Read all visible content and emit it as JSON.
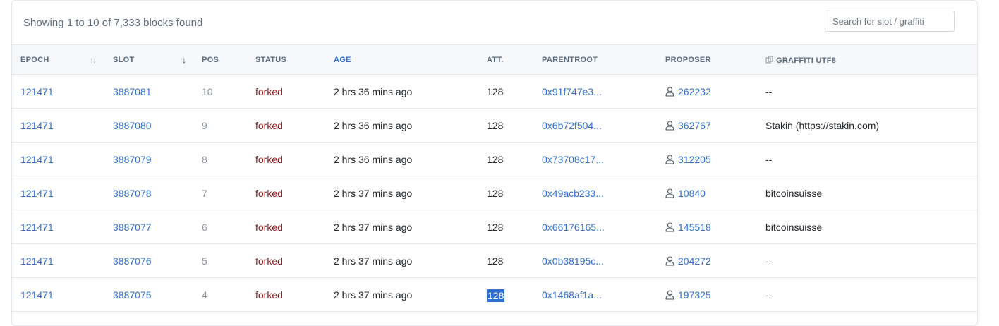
{
  "summary": "Showing 1 to 10 of 7,333 blocks found",
  "search": {
    "placeholder": "Search for slot / graffiti"
  },
  "columns": {
    "epoch": "EPOCH",
    "slot": "SLOT",
    "pos": "POS",
    "status": "STATUS",
    "age": "AGE",
    "att": "ATT.",
    "parentroot": "PARENTROOT",
    "proposer": "PROPOSER",
    "graffiti": "GRAFFITI UTF8"
  },
  "rows": [
    {
      "epoch": "121471",
      "slot": "3887081",
      "pos": "10",
      "status": "forked",
      "age": "2 hrs 36 mins ago",
      "att": "128",
      "parentroot": "0x91f747e3...",
      "proposer": "262232",
      "graffiti": "--"
    },
    {
      "epoch": "121471",
      "slot": "3887080",
      "pos": "9",
      "status": "forked",
      "age": "2 hrs 36 mins ago",
      "att": "128",
      "parentroot": "0x6b72f504...",
      "proposer": "362767",
      "graffiti": "Stakin (https://stakin.com)"
    },
    {
      "epoch": "121471",
      "slot": "3887079",
      "pos": "8",
      "status": "forked",
      "age": "2 hrs 36 mins ago",
      "att": "128",
      "parentroot": "0x73708c17...",
      "proposer": "312205",
      "graffiti": "--"
    },
    {
      "epoch": "121471",
      "slot": "3887078",
      "pos": "7",
      "status": "forked",
      "age": "2 hrs 37 mins ago",
      "att": "128",
      "parentroot": "0x49acb233...",
      "proposer": "10840",
      "graffiti": "bitcoinsuisse"
    },
    {
      "epoch": "121471",
      "slot": "3887077",
      "pos": "6",
      "status": "forked",
      "age": "2 hrs 37 mins ago",
      "att": "128",
      "parentroot": "0x66176165...",
      "proposer": "145518",
      "graffiti": "bitcoinsuisse"
    },
    {
      "epoch": "121471",
      "slot": "3887076",
      "pos": "5",
      "status": "forked",
      "age": "2 hrs 37 mins ago",
      "att": "128",
      "parentroot": "0x0b38195c...",
      "proposer": "204272",
      "graffiti": "--"
    },
    {
      "epoch": "121471",
      "slot": "3887075",
      "pos": "4",
      "status": "forked",
      "age": "2 hrs 37 mins ago",
      "att": "128",
      "parentroot": "0x1468af1a...",
      "proposer": "197325",
      "graffiti": "--",
      "att_selected": true
    }
  ],
  "colors": {
    "link": "#2f6fd1",
    "forked": "#8b1a1a",
    "header_bg": "#f6f8fb",
    "selection": "#2f6fd1"
  },
  "icons": {
    "sort": "sort-arrows-icon",
    "proposer": "person-icon",
    "graffiti": "copy-icon"
  }
}
